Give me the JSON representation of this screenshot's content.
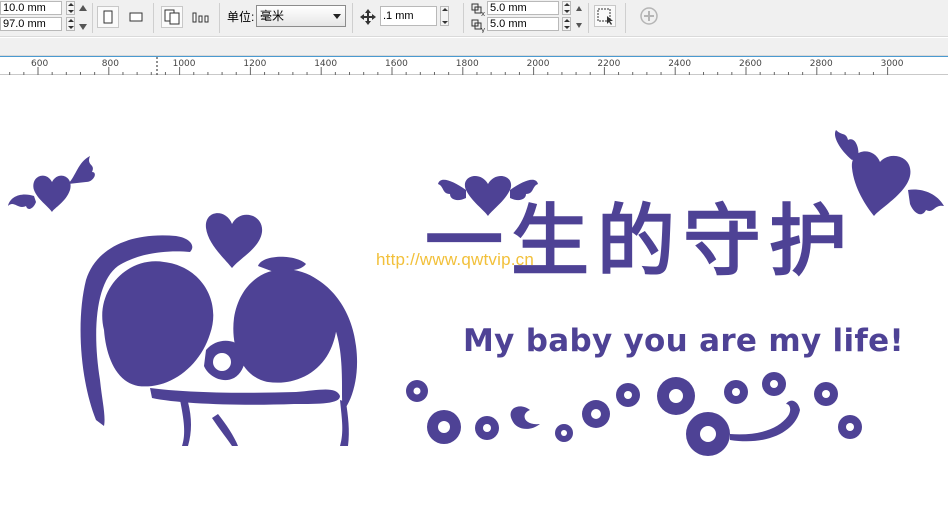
{
  "toolbar": {
    "x_value": "10.0 mm",
    "y_value": "97.0 mm",
    "units_label": "单位:",
    "units_value": "毫米",
    "nudge_value": ".1 mm",
    "dup_x_value": "5.0 mm",
    "dup_y_value": "5.0 mm"
  },
  "ruler": {
    "ticks": [
      "600",
      "800",
      "1000",
      "1200",
      "1400",
      "1600",
      "1800",
      "2000",
      "2200",
      "2400",
      "2600",
      "2800",
      "3000"
    ]
  },
  "artwork": {
    "watermark": "http://www.qwtvip.cn",
    "chinese_title": "一生的守护",
    "english_title": "My baby you are my life!",
    "color": "#4e4295"
  },
  "colors": {
    "accent_ruler": "#4a9ad0",
    "watermark": "#f2c03a",
    "artwork": "#4e4295"
  }
}
